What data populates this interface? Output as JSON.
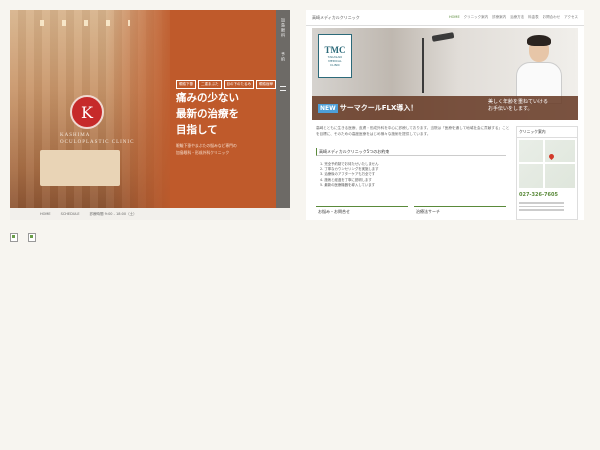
{
  "left": {
    "logo_text": "KASHIMA\nOCULOPLASTIC CLINIC",
    "tags": [
      "眼瞼下垂",
      "二重まぶた",
      "目の下のたるみ",
      "眼瞼痙攣"
    ],
    "headline": [
      "痛みの少ない",
      "最新の治療を",
      "目指して"
    ],
    "subtext": [
      "眼瞼下垂やまぶたの悩みなど専門の",
      "加島眼科・形成外科クリニック"
    ],
    "sidebar_texts": [
      "加島眼科",
      "予約"
    ],
    "footer": [
      "HOME",
      "SCHEDULE",
      "診療時間 9:00 - 18:00（土）"
    ]
  },
  "right": {
    "site_name": "高崎メディカルクリニック",
    "nav": [
      "HOME",
      "クリニック案内",
      "診療案内",
      "治療方法",
      "料金表",
      "お問合わせ",
      "アクセス"
    ],
    "logo_main": "TMC",
    "logo_sub": "TAKASAKI\nMEDICAL\nCLINIC",
    "banner_new": "NEW",
    "banner_text": "サーマクールFLX導入！",
    "banner_right": "美しく年齢を重ねていける\nお手伝いをします。",
    "intro": "高崎とともに生きる医療、皮膚・形成外科を中心に診療しております。当院は「医療を通して地域社会に貢献する」ことを目標に、そのための高度医療をはじめ様々な施術を提供しています。",
    "section_heading": "高崎メディカルクリニック5つのお約束",
    "promises": [
      "1. 完全予約制でお待たせいたしません",
      "2. 丁寧なカウンセリングを実施します",
      "3. 治療後のアフターケアも万全です",
      "4. 施術と経過を丁寧に説明します",
      "5. 最新の医療機器を導入しています"
    ],
    "box1": "お悩み・お問合せ",
    "box2": "治療法サーチ",
    "side_heading": "クリニック案内",
    "phone": "027-326-7605"
  },
  "colors": {
    "left_bg": "#bf5a2b",
    "accent_green": "#5a8a3a",
    "tmc_teal": "#2c6a7a"
  }
}
